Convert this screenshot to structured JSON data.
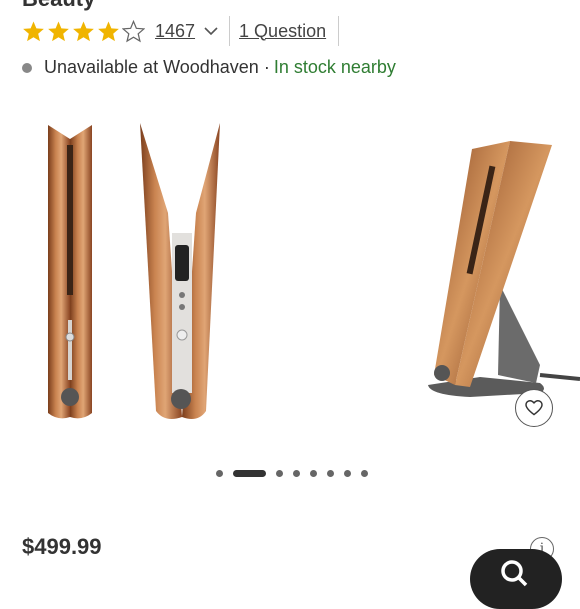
{
  "product": {
    "title_fragment": "Beauty",
    "rating_stars": 4,
    "rating_max": 5,
    "review_count": "1467",
    "questions_link": "1 Question",
    "availability": {
      "store_status": "Unavailable at Woodhaven",
      "separator": "·",
      "nearby_status": "In stock nearby"
    },
    "price": "$499.99"
  },
  "gallery": {
    "image_count": 8,
    "active_index": 1,
    "wishlist_icon": "heart-icon"
  },
  "icons": {
    "star": "star-icon",
    "chevron": "chevron-down-icon",
    "info": "info-icon",
    "search": "search-icon"
  },
  "colors": {
    "star_gold": "#f0b400",
    "in_stock_green": "#2f7d32",
    "copper": "#b8713f"
  }
}
